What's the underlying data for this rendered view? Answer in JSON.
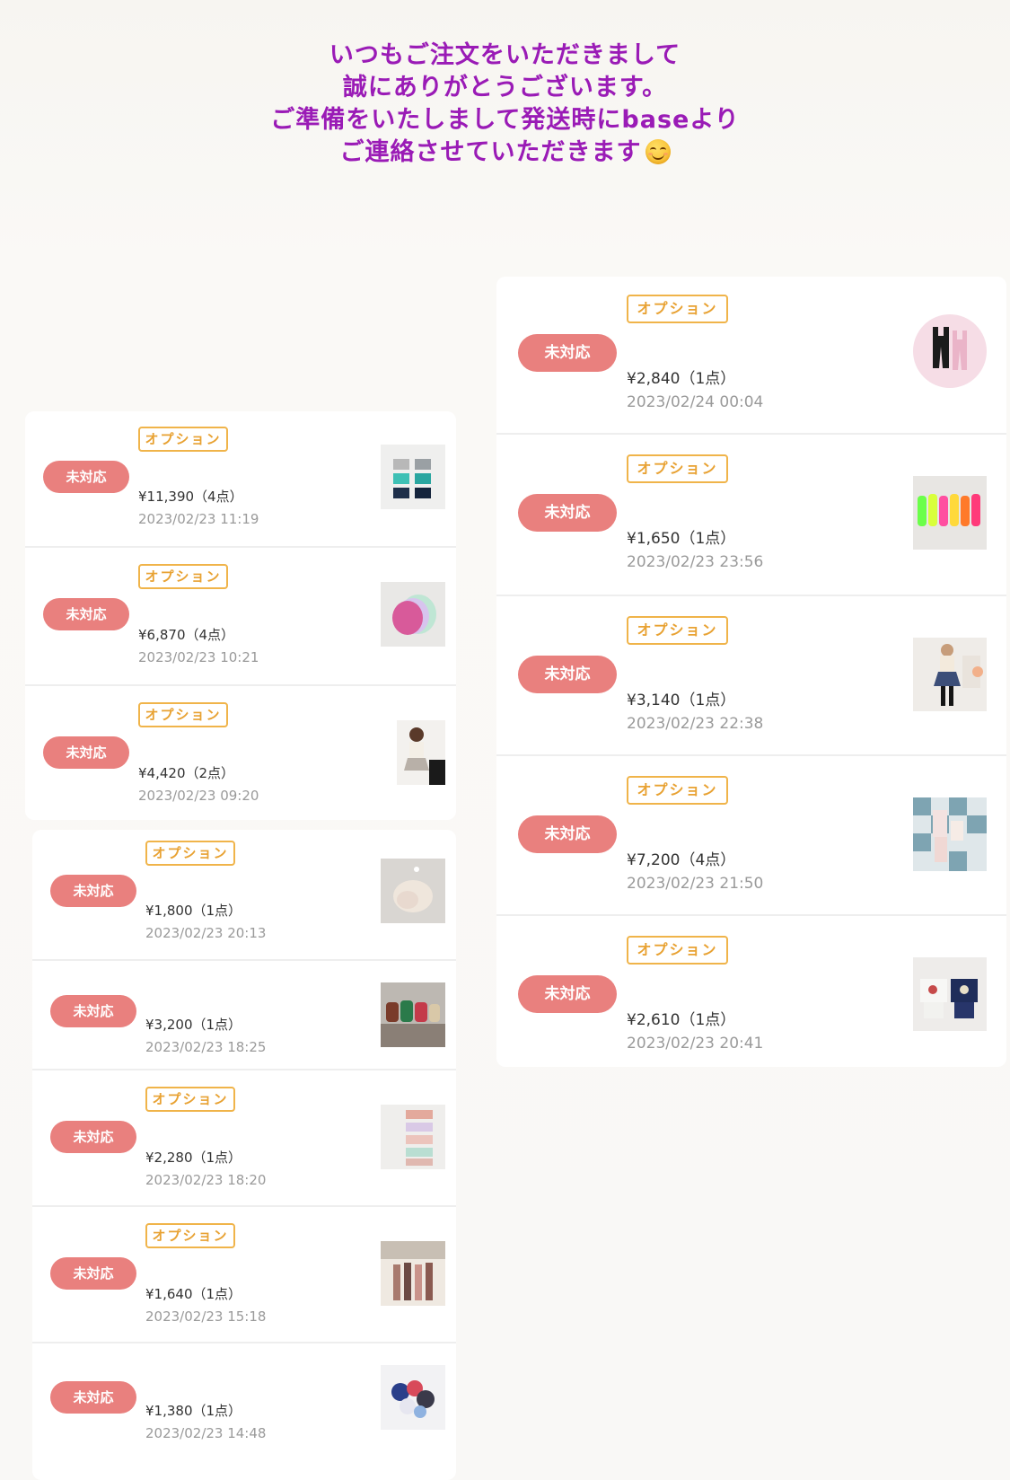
{
  "header": {
    "lines": [
      "いつもご注文をいただきまして",
      "誠にありがとうございます。",
      "ご準備をいたしまして発送時にbaseより",
      "ご連絡させていただきます"
    ]
  },
  "labels": {
    "status": "未対応",
    "option": "オプション"
  },
  "colors": {
    "header_text": "#9a1bb6",
    "status_bg": "#e9807e",
    "option_border": "#f0b44a"
  },
  "right_orders": [
    {
      "price": "¥2,840（1点）",
      "date": "2023/02/24 00:04",
      "has_option": true
    },
    {
      "price": "¥1,650（1点）",
      "date": "2023/02/23 23:56",
      "has_option": true
    },
    {
      "price": "¥3,140（1点）",
      "date": "2023/02/23 22:38",
      "has_option": true
    },
    {
      "price": "¥7,200（4点）",
      "date": "2023/02/23 21:50",
      "has_option": true
    },
    {
      "price": "¥2,610（1点）",
      "date": "2023/02/23 20:41",
      "has_option": true
    }
  ],
  "left_orders_1": [
    {
      "price": "¥11,390（4点）",
      "date": "2023/02/23 11:19",
      "has_option": true
    },
    {
      "price": "¥6,870（4点）",
      "date": "2023/02/23 10:21",
      "has_option": true
    },
    {
      "price": "¥4,420（2点）",
      "date": "2023/02/23 09:20",
      "has_option": true
    }
  ],
  "left_orders_2": [
    {
      "price": "¥1,800（1点）",
      "date": "2023/02/23 20:13",
      "has_option": true
    },
    {
      "price": "¥3,200（1点）",
      "date": "2023/02/23 18:25",
      "has_option": false
    },
    {
      "price": "¥2,280（1点）",
      "date": "2023/02/23 18:20",
      "has_option": true
    },
    {
      "price": "¥1,640（1点）",
      "date": "2023/02/23 15:18",
      "has_option": true
    },
    {
      "price": "¥1,380（1点）",
      "date": "2023/02/23 14:48",
      "has_option": false
    }
  ]
}
